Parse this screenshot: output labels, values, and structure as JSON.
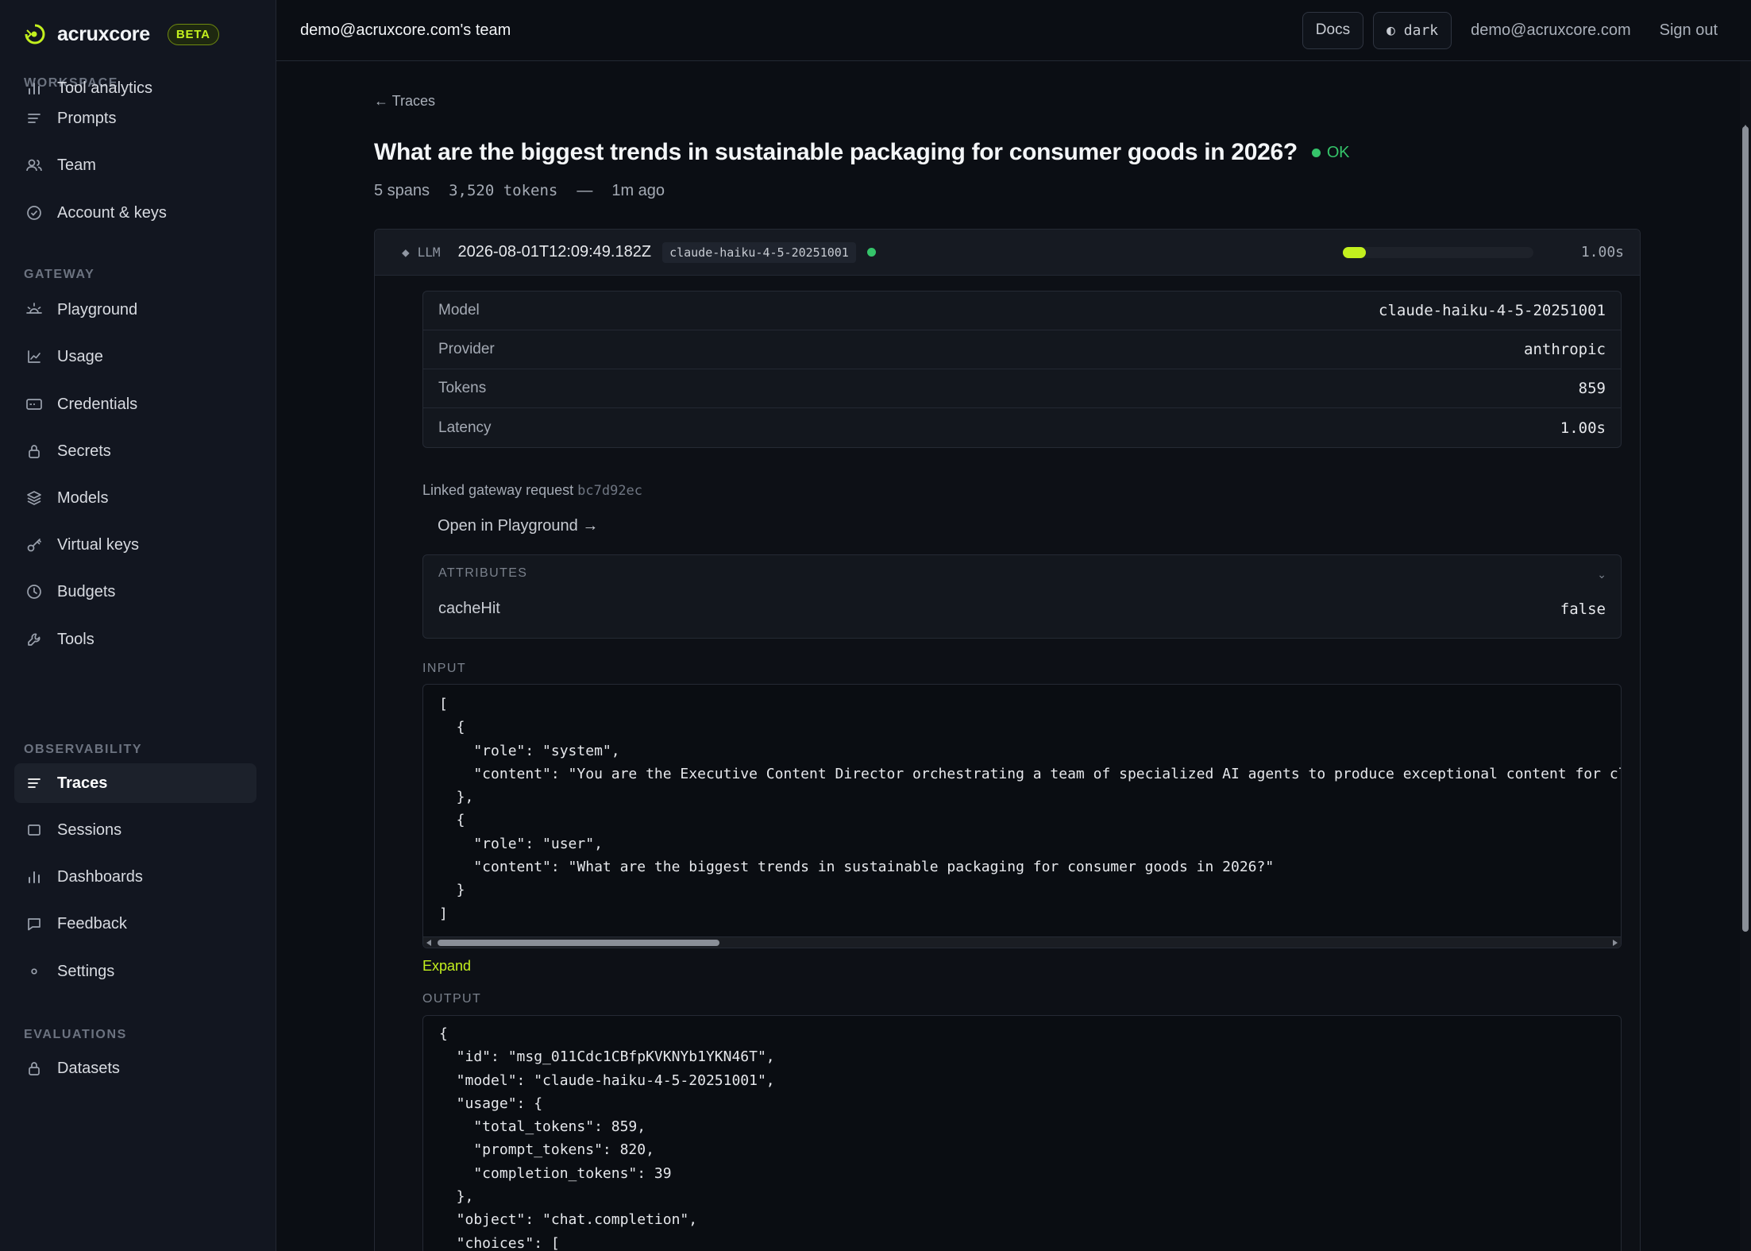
{
  "brand": {
    "name": "acruxcore",
    "badge": "BETA",
    "accent": "#c3f01e"
  },
  "sidebar": {
    "sections": [
      {
        "label": "WORKSPACE",
        "items": [
          {
            "label": "Prompts",
            "icon": "lines-icon"
          },
          {
            "label": "Team",
            "icon": "users-icon"
          },
          {
            "label": "Account & keys",
            "icon": "check-circle-icon"
          }
        ]
      },
      {
        "label": "GATEWAY",
        "items": [
          {
            "label": "Playground",
            "icon": "sun-icon"
          },
          {
            "label": "Usage",
            "icon": "line-chart-icon"
          },
          {
            "label": "Credentials",
            "icon": "card-icon"
          },
          {
            "label": "Secrets",
            "icon": "lock-icon"
          },
          {
            "label": "Models",
            "icon": "layers-icon"
          },
          {
            "label": "Virtual keys",
            "icon": "key-icon"
          },
          {
            "label": "Budgets",
            "icon": "clock-icon"
          },
          {
            "label": "Tools",
            "icon": "wrench-icon"
          },
          {
            "label": "Tool analytics",
            "icon": "bar-chart-icon"
          }
        ]
      },
      {
        "label": "OBSERVABILITY",
        "items": [
          {
            "label": "Traces",
            "icon": "lines-icon",
            "active": true
          },
          {
            "label": "Sessions",
            "icon": "square-icon"
          },
          {
            "label": "Dashboards",
            "icon": "bar-chart-icon"
          },
          {
            "label": "Feedback",
            "icon": "message-icon"
          },
          {
            "label": "Settings",
            "icon": "dot-icon"
          }
        ]
      },
      {
        "label": "EVALUATIONS",
        "items": [
          {
            "label": "Datasets",
            "icon": "lock-icon"
          }
        ]
      }
    ]
  },
  "topbar": {
    "team": "demo@acruxcore.com's team",
    "docs": "Docs",
    "theme": "◐ dark",
    "email": "demo@acruxcore.com",
    "signout": "Sign out"
  },
  "trace": {
    "back": "← Traces",
    "title": "What are the biggest trends in sustainable packaging for consumer goods in 2026?",
    "status": "OK",
    "spans": "5 spans",
    "tokens": "3,520 tokens",
    "dash": "—",
    "ago": "1m ago"
  },
  "span": {
    "kind": "LLM",
    "kind_icon": "diamond-icon",
    "timestamp": "2026-08-01T12:09:49.182Z",
    "model": "claude-haiku-4-5-20251001",
    "progress": 0.12,
    "duration": "1.00s",
    "details": [
      {
        "key": "Model",
        "value": "claude-haiku-4-5-20251001"
      },
      {
        "key": "Provider",
        "value": "anthropic"
      },
      {
        "key": "Tokens",
        "value": "859"
      },
      {
        "key": "Latency",
        "value": "1.00s"
      }
    ],
    "linked_label": "Linked gateway request",
    "linked_hash": "bc7d92ec",
    "open_playground": "Open in Playground →",
    "attributes_title": "ATTRIBUTES",
    "attributes": [
      {
        "key": "cacheHit",
        "value": "false"
      }
    ],
    "input_label": "INPUT",
    "input_lines": [
      "[",
      "  {",
      "    \"role\": \"system\",",
      "    \"content\": \"You are the Executive Content Director orchestrating a team of specialized AI agents to produce exceptional content for cl",
      "  },",
      "  {",
      "    \"role\": \"user\",",
      "    \"content\": \"What are the biggest trends in sustainable packaging for consumer goods in 2026?\"",
      "  }",
      "]"
    ],
    "expand": "Expand",
    "output_label": "OUTPUT",
    "output_lines": [
      "{",
      "  \"id\": \"msg_011Cdc1CBfpKVKNYb1YKN46T\",",
      "  \"model\": \"claude-haiku-4-5-20251001\",",
      "  \"usage\": {",
      "    \"total_tokens\": 859,",
      "    \"prompt_tokens\": 820,",
      "    \"completion_tokens\": 39",
      "  },",
      "  \"object\": \"chat.completion\",",
      "  \"choices\": ["
    ]
  }
}
